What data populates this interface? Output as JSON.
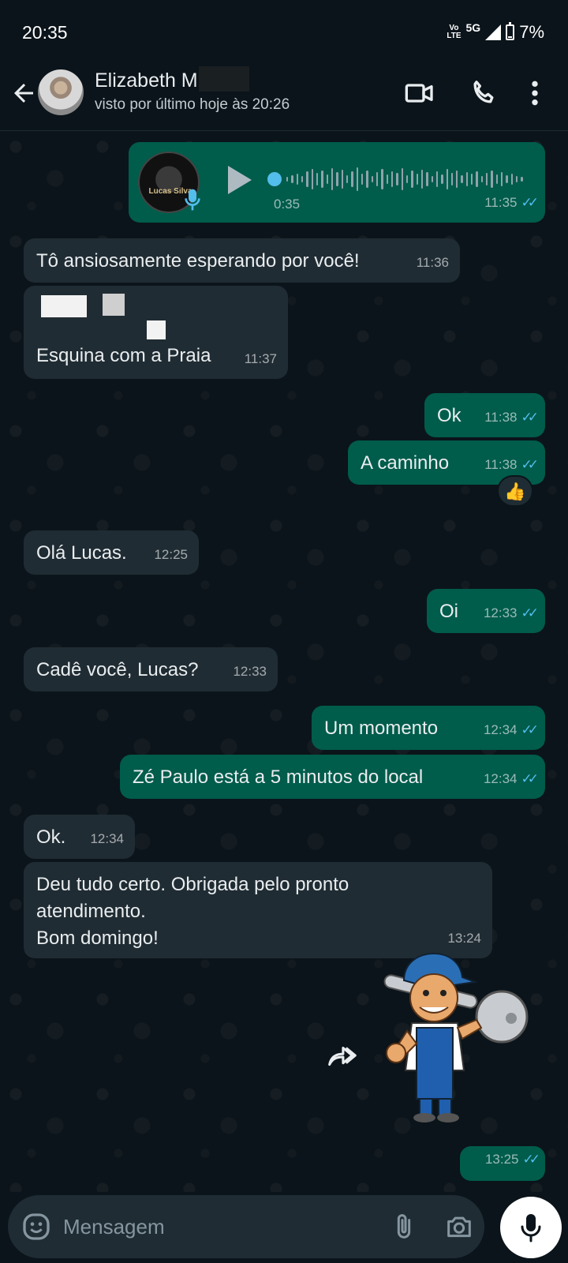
{
  "status_bar": {
    "time": "20:35",
    "volte": "Vo LTE",
    "network": "5G",
    "battery": "7%"
  },
  "header": {
    "contact_name": "Elizabeth M",
    "last_seen": "visto por último hoje às 20:26"
  },
  "messages": [
    {
      "type": "audio",
      "direction": "out",
      "duration": "0:35",
      "time": "11:35",
      "read": true,
      "art_label": "Lucas Silva"
    },
    {
      "type": "text",
      "direction": "in",
      "text": "Tô ansiosamente esperando por você!",
      "time": "11:36"
    },
    {
      "type": "text",
      "direction": "in",
      "text": "Esquina com a Praia",
      "time": "11:37"
    },
    {
      "type": "text",
      "direction": "out",
      "text": "Ok",
      "time": "11:38",
      "read": true
    },
    {
      "type": "text",
      "direction": "out",
      "text": "A caminho",
      "time": "11:38",
      "read": true,
      "reaction": "👍"
    },
    {
      "type": "text",
      "direction": "in",
      "text": "Olá Lucas.",
      "time": "12:25"
    },
    {
      "type": "text",
      "direction": "out",
      "text": "Oi",
      "time": "12:33",
      "read": true
    },
    {
      "type": "text",
      "direction": "in",
      "text": "Cadê você, Lucas?",
      "time": "12:33"
    },
    {
      "type": "text",
      "direction": "out",
      "text": "Um momento",
      "time": "12:34",
      "read": true
    },
    {
      "type": "text",
      "direction": "out",
      "text": "Zé Paulo está a 5 minutos do local",
      "time": "12:34",
      "read": true
    },
    {
      "type": "text",
      "direction": "in",
      "text": "Ok.",
      "time": "12:34"
    },
    {
      "type": "text",
      "direction": "in",
      "lines": [
        "Deu tudo certo. Obrigada pelo pronto",
        "atendimento.",
        "Bom domingo!"
      ],
      "time": "13:24"
    },
    {
      "type": "sticker",
      "direction": "out",
      "time": "13:25",
      "read": true,
      "sticker_icon": "locksmith-sticker"
    }
  ],
  "read_ticks": "✓✓",
  "input": {
    "placeholder": "Mensagem"
  },
  "colors": {
    "background": "#0b141a",
    "incoming_bubble": "#202c33",
    "outgoing_bubble": "#005c4b",
    "read_tick": "#53bdeb"
  }
}
